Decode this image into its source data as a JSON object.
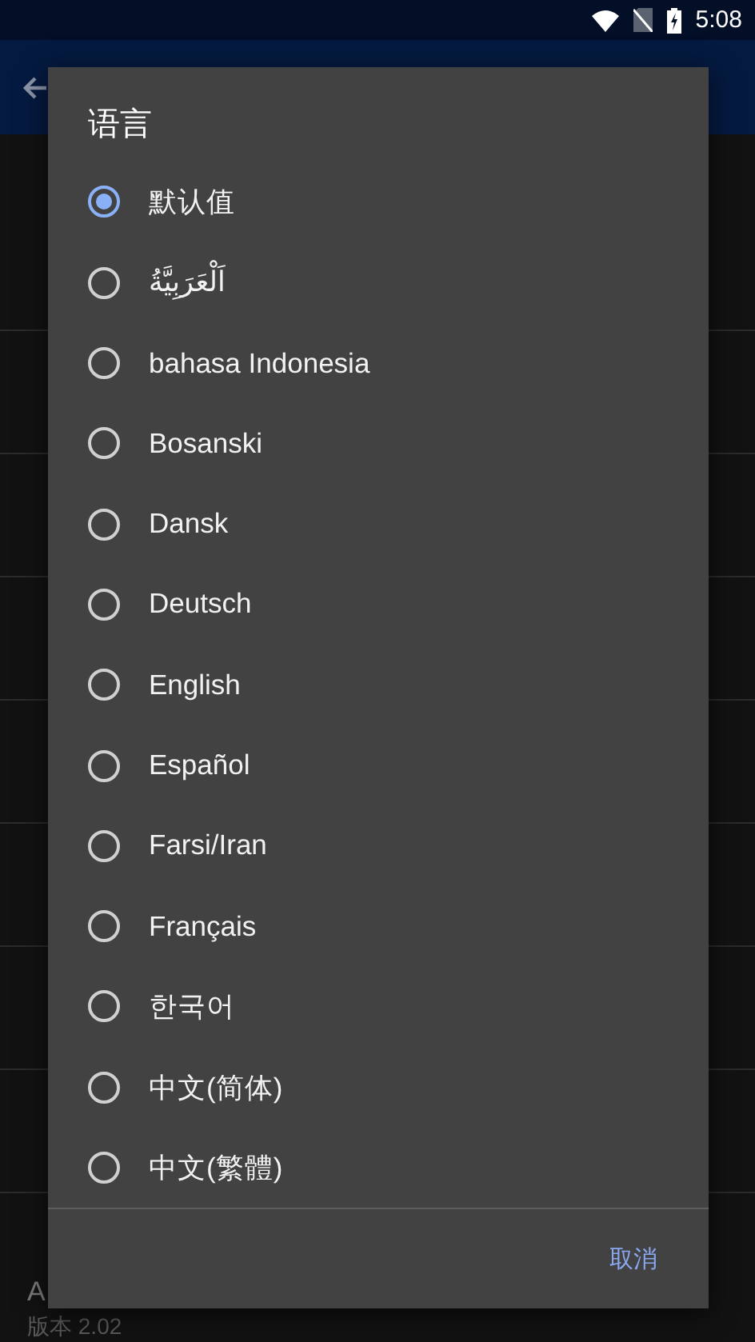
{
  "status_bar": {
    "time": "5:08"
  },
  "settings": {
    "about": {
      "title": "A",
      "subtitle": "版本 2.02"
    }
  },
  "dialog": {
    "title": "语言",
    "options": [
      {
        "label": "默认值",
        "selected": true
      },
      {
        "label": "اَلْعَرَبِيَّةُ",
        "selected": false
      },
      {
        "label": "bahasa Indonesia",
        "selected": false
      },
      {
        "label": "Bosanski",
        "selected": false
      },
      {
        "label": "Dansk",
        "selected": false
      },
      {
        "label": "Deutsch",
        "selected": false
      },
      {
        "label": "English",
        "selected": false
      },
      {
        "label": "Español",
        "selected": false
      },
      {
        "label": "Farsi/Iran",
        "selected": false
      },
      {
        "label": "Français",
        "selected": false
      },
      {
        "label": "한국어",
        "selected": false
      },
      {
        "label": "中文(简体)",
        "selected": false
      },
      {
        "label": "中文(繁體)",
        "selected": false
      }
    ],
    "buttons": [
      "取消"
    ]
  }
}
